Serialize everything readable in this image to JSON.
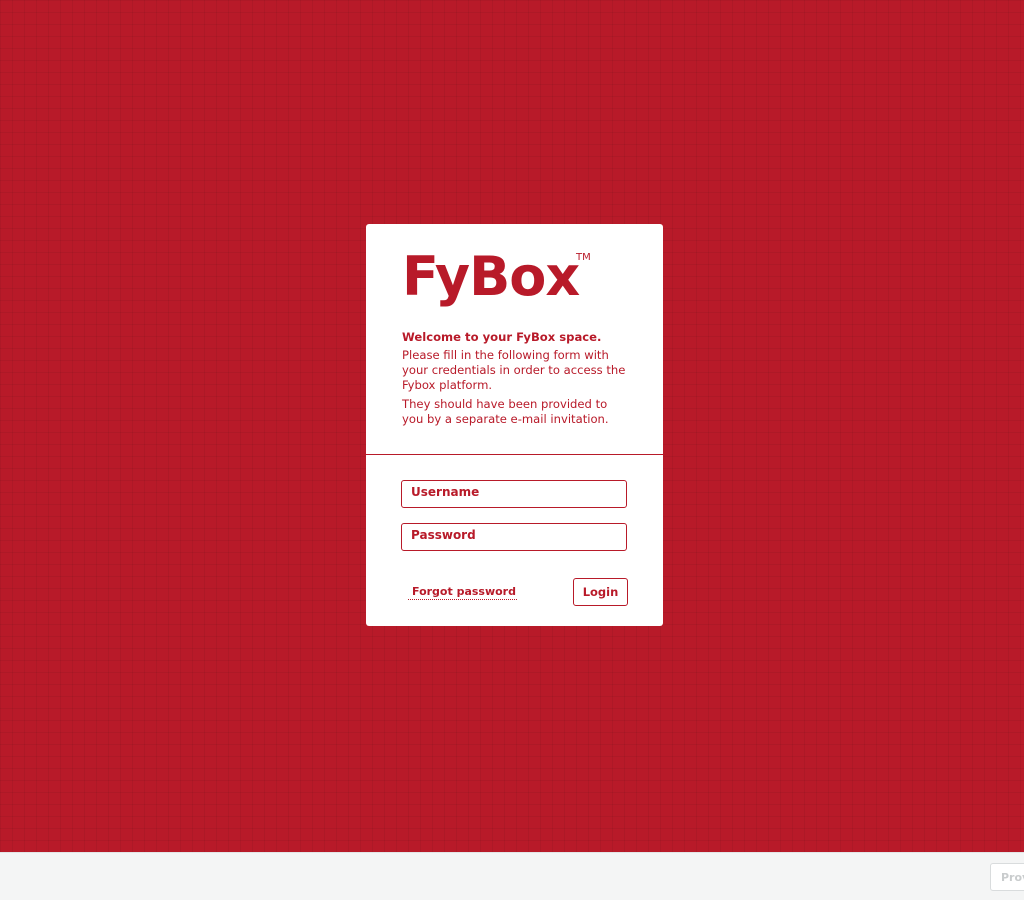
{
  "colors": {
    "brand": "#b81a29",
    "card_background": "#ffffff",
    "footer_background": "#f4f5f5"
  },
  "card": {
    "logo": "FyBox",
    "trademark": "TM",
    "welcome": "Welcome to your FyBox space.",
    "paragraph1": "Please fill in the following form with your credentials in order to access the Fybox platform.",
    "paragraph2": "They should have been provided to you by a separate e-mail invitation."
  },
  "form": {
    "username_placeholder": "Username",
    "username_value": "",
    "password_placeholder": "Password",
    "password_value": "",
    "forgot_label": "Forgot password",
    "login_label": "Login"
  },
  "footer": {
    "button_label": "Prov"
  }
}
